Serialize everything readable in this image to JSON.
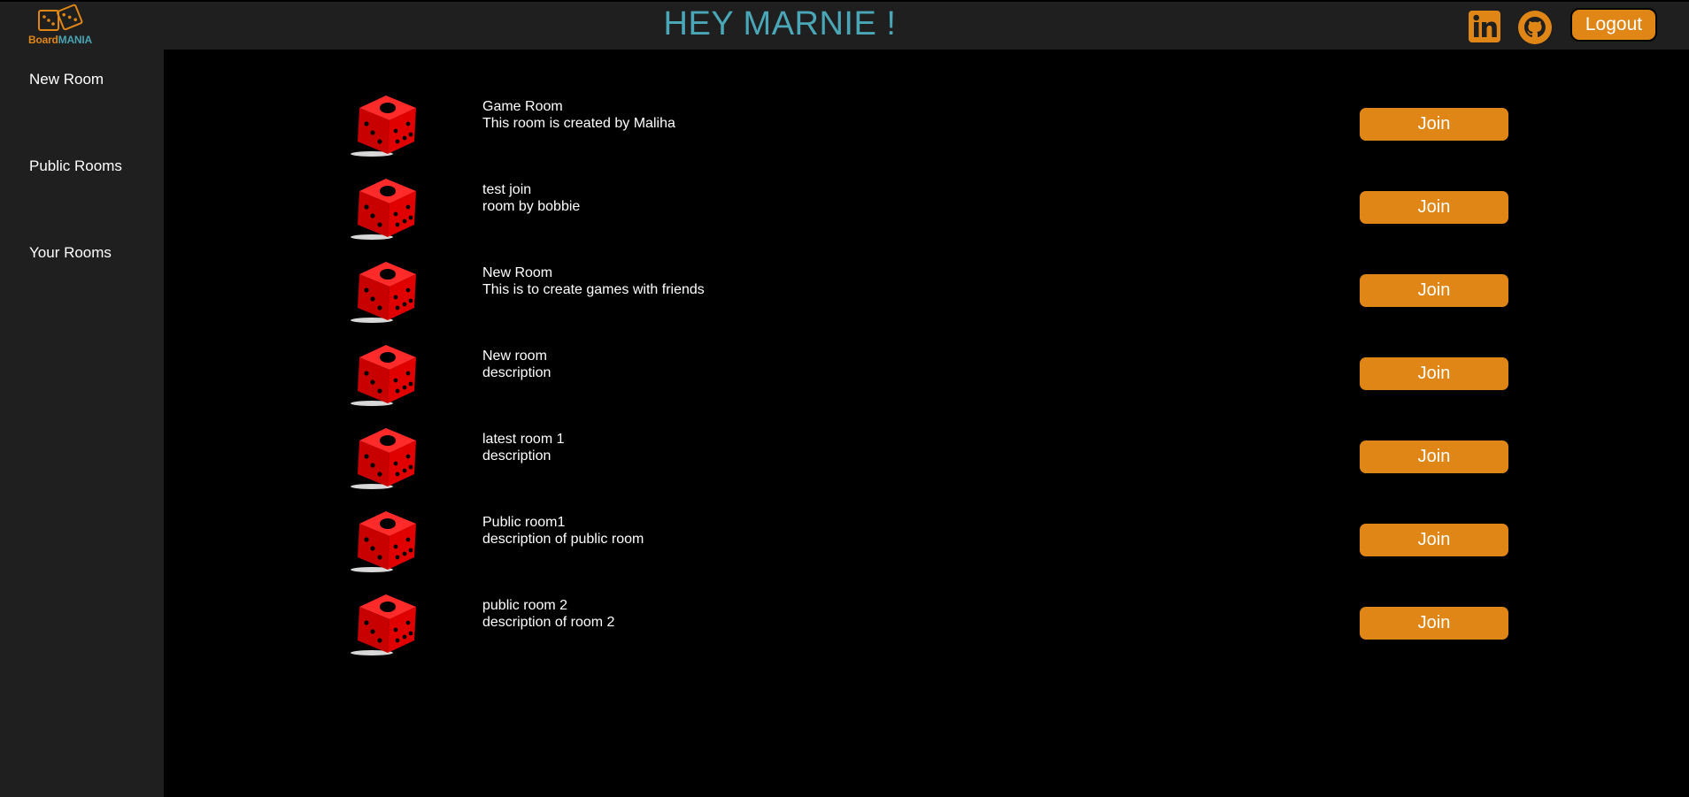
{
  "header": {
    "logo_board": "Board",
    "logo_mania": "MANIA",
    "greeting": "HEY MARNIE !",
    "logout_label": "Logout"
  },
  "colors": {
    "accent": "#e08616",
    "greeting": "#4aa7b8",
    "dice": "#e00000",
    "panel": "#1f1f1f"
  },
  "sidebar": {
    "items": [
      {
        "label": "New Room"
      },
      {
        "label": "Public Rooms"
      },
      {
        "label": "Your Rooms"
      }
    ]
  },
  "rooms": [
    {
      "name": "Game Room",
      "description": "This room is created by Maliha",
      "join_label": "Join"
    },
    {
      "name": "test join",
      "description": "room by bobbie",
      "join_label": "Join"
    },
    {
      "name": "New Room",
      "description": "This is to create games with friends",
      "join_label": "Join"
    },
    {
      "name": "New room",
      "description": "description",
      "join_label": "Join"
    },
    {
      "name": "latest room 1",
      "description": "description",
      "join_label": "Join"
    },
    {
      "name": "Public room1",
      "description": "description of public room",
      "join_label": "Join"
    },
    {
      "name": "public room 2",
      "description": "description of room 2",
      "join_label": "Join"
    }
  ]
}
